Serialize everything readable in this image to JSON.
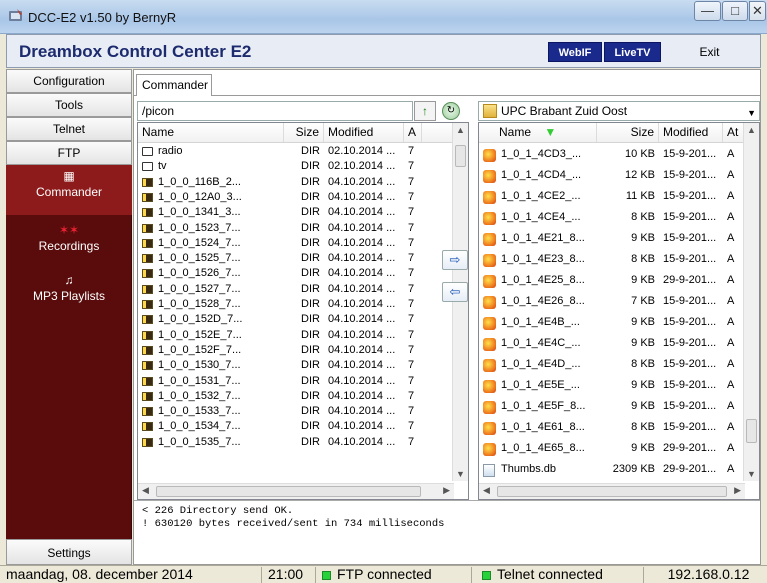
{
  "window": {
    "title": "DCC-E2 v1.50 by BernyR"
  },
  "header": {
    "title": "Dreambox Control Center E2",
    "webif_label": "WebIF",
    "livetv_label": "LiveTV",
    "exit_label": "Exit"
  },
  "sidebar": {
    "buttons": [
      "Configuration",
      "Tools",
      "Telnet",
      "FTP"
    ],
    "items": [
      {
        "label": "Commander"
      },
      {
        "label": "Recordings"
      },
      {
        "label": "MP3 Playlists"
      }
    ],
    "settings_label": "Settings"
  },
  "commander": {
    "tab_label": "Commander",
    "left": {
      "path": "/picon",
      "columns": [
        "Name",
        "Size",
        "Modified",
        "A"
      ],
      "rows": [
        {
          "name": "radio",
          "size": "DIR",
          "modified": "02.10.2014 ...",
          "a": "7",
          "icon": "folder-icon"
        },
        {
          "name": "tv",
          "size": "DIR",
          "modified": "02.10.2014 ...",
          "a": "7",
          "icon": "folder-icon"
        },
        {
          "name": "1_0_0_116B_2...",
          "size": "DIR",
          "modified": "04.10.2014 ...",
          "a": "7",
          "icon": "picon-icon"
        },
        {
          "name": "1_0_0_12A0_3...",
          "size": "DIR",
          "modified": "04.10.2014 ...",
          "a": "7",
          "icon": "picon-icon"
        },
        {
          "name": "1_0_0_1341_3...",
          "size": "DIR",
          "modified": "04.10.2014 ...",
          "a": "7",
          "icon": "picon-icon"
        },
        {
          "name": "1_0_0_1523_7...",
          "size": "DIR",
          "modified": "04.10.2014 ...",
          "a": "7",
          "icon": "picon-icon"
        },
        {
          "name": "1_0_0_1524_7...",
          "size": "DIR",
          "modified": "04.10.2014 ...",
          "a": "7",
          "icon": "picon-icon"
        },
        {
          "name": "1_0_0_1525_7...",
          "size": "DIR",
          "modified": "04.10.2014 ...",
          "a": "7",
          "icon": "picon-icon"
        },
        {
          "name": "1_0_0_1526_7...",
          "size": "DIR",
          "modified": "04.10.2014 ...",
          "a": "7",
          "icon": "picon-icon"
        },
        {
          "name": "1_0_0_1527_7...",
          "size": "DIR",
          "modified": "04.10.2014 ...",
          "a": "7",
          "icon": "picon-icon"
        },
        {
          "name": "1_0_0_1528_7...",
          "size": "DIR",
          "modified": "04.10.2014 ...",
          "a": "7",
          "icon": "picon-icon"
        },
        {
          "name": "1_0_0_152D_7...",
          "size": "DIR",
          "modified": "04.10.2014 ...",
          "a": "7",
          "icon": "picon-icon"
        },
        {
          "name": "1_0_0_152E_7...",
          "size": "DIR",
          "modified": "04.10.2014 ...",
          "a": "7",
          "icon": "picon-icon"
        },
        {
          "name": "1_0_0_152F_7...",
          "size": "DIR",
          "modified": "04.10.2014 ...",
          "a": "7",
          "icon": "picon-icon"
        },
        {
          "name": "1_0_0_1530_7...",
          "size": "DIR",
          "modified": "04.10.2014 ...",
          "a": "7",
          "icon": "picon-icon"
        },
        {
          "name": "1_0_0_1531_7...",
          "size": "DIR",
          "modified": "04.10.2014 ...",
          "a": "7",
          "icon": "picon-icon"
        },
        {
          "name": "1_0_0_1532_7...",
          "size": "DIR",
          "modified": "04.10.2014 ...",
          "a": "7",
          "icon": "picon-icon"
        },
        {
          "name": "1_0_0_1533_7...",
          "size": "DIR",
          "modified": "04.10.2014 ...",
          "a": "7",
          "icon": "picon-icon"
        },
        {
          "name": "1_0_0_1534_7...",
          "size": "DIR",
          "modified": "04.10.2014 ...",
          "a": "7",
          "icon": "picon-icon"
        },
        {
          "name": "1_0_0_1535_7...",
          "size": "DIR",
          "modified": "04.10.2014 ...",
          "a": "7",
          "icon": "picon-icon"
        }
      ]
    },
    "right": {
      "folder": "UPC Brabant Zuid Oost",
      "columns": [
        "Name",
        "Size",
        "Modified",
        "At"
      ],
      "rows": [
        {
          "name": "1_0_1_4CD3_...",
          "size": "10 KB",
          "modified": "15-9-201...",
          "a": "A",
          "icon": "png-icon"
        },
        {
          "name": "1_0_1_4CD4_...",
          "size": "12 KB",
          "modified": "15-9-201...",
          "a": "A",
          "icon": "png-icon"
        },
        {
          "name": "1_0_1_4CE2_...",
          "size": "11 KB",
          "modified": "15-9-201...",
          "a": "A",
          "icon": "png-icon"
        },
        {
          "name": "1_0_1_4CE4_...",
          "size": "8 KB",
          "modified": "15-9-201...",
          "a": "A",
          "icon": "png-icon"
        },
        {
          "name": "1_0_1_4E21_8...",
          "size": "9 KB",
          "modified": "15-9-201...",
          "a": "A",
          "icon": "png-icon"
        },
        {
          "name": "1_0_1_4E23_8...",
          "size": "8 KB",
          "modified": "15-9-201...",
          "a": "A",
          "icon": "png-icon"
        },
        {
          "name": "1_0_1_4E25_8...",
          "size": "9 KB",
          "modified": "29-9-201...",
          "a": "A",
          "icon": "png-icon"
        },
        {
          "name": "1_0_1_4E26_8...",
          "size": "7 KB",
          "modified": "15-9-201...",
          "a": "A",
          "icon": "png-icon"
        },
        {
          "name": "1_0_1_4E4B_...",
          "size": "9 KB",
          "modified": "15-9-201...",
          "a": "A",
          "icon": "png-icon"
        },
        {
          "name": "1_0_1_4E4C_...",
          "size": "9 KB",
          "modified": "15-9-201...",
          "a": "A",
          "icon": "png-icon"
        },
        {
          "name": "1_0_1_4E4D_...",
          "size": "8 KB",
          "modified": "15-9-201...",
          "a": "A",
          "icon": "png-icon"
        },
        {
          "name": "1_0_1_4E5E_...",
          "size": "9 KB",
          "modified": "15-9-201...",
          "a": "A",
          "icon": "png-icon"
        },
        {
          "name": "1_0_1_4E5F_8...",
          "size": "9 KB",
          "modified": "15-9-201...",
          "a": "A",
          "icon": "png-icon"
        },
        {
          "name": "1_0_1_4E61_8...",
          "size": "8 KB",
          "modified": "15-9-201...",
          "a": "A",
          "icon": "png-icon"
        },
        {
          "name": "1_0_1_4E65_8...",
          "size": "9 KB",
          "modified": "29-9-201...",
          "a": "A",
          "icon": "png-icon"
        },
        {
          "name": "Thumbs.db",
          "size": "2309 KB",
          "modified": "29-9-201...",
          "a": "A",
          "icon": "db-icon"
        }
      ]
    },
    "log_lines": [
      "< 226 Directory send OK.",
      "! 630120 bytes received/sent in 734 milliseconds"
    ]
  },
  "status": {
    "date": "maandag, 08. december 2014",
    "time": "21:00",
    "ftp": "FTP connected",
    "telnet": "Telnet connected",
    "ip": "192.168.0.12",
    "led_color": "#27d13a"
  },
  "colors": {
    "sidebar_bg": "#5a0c0c",
    "sidebar_active": "#8e1b1b",
    "title_text": "#1c2a6e",
    "header_button": "#1a2a8c"
  }
}
